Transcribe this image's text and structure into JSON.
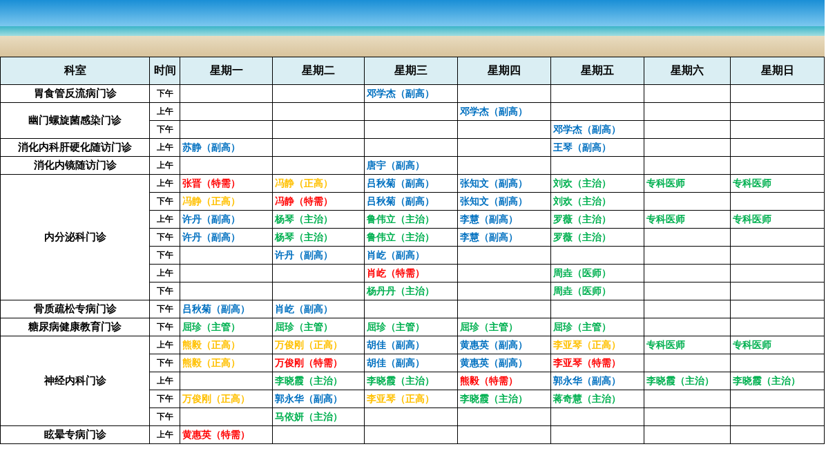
{
  "table": {
    "columns": [
      "科室",
      "时间",
      "星期一",
      "星期二",
      "星期三",
      "星期四",
      "星期五",
      "星期六",
      "星期日"
    ],
    "groups": [
      {
        "department": "胃食管反流病门诊",
        "rows": [
          {
            "time": "下午",
            "cells": [
              null,
              null,
              {
                "text": "邓学杰（副高）",
                "color": "#0070c0"
              },
              null,
              null,
              null,
              null
            ]
          }
        ]
      },
      {
        "department": "幽门螺旋菌感染门诊",
        "rows": [
          {
            "time": "上午",
            "cells": [
              null,
              null,
              null,
              {
                "text": "邓学杰（副高）",
                "color": "#0070c0"
              },
              null,
              null,
              null
            ]
          },
          {
            "time": "下午",
            "cells": [
              null,
              null,
              null,
              null,
              {
                "text": "邓学杰（副高）",
                "color": "#0070c0"
              },
              null,
              null
            ]
          }
        ]
      },
      {
        "department": "消化内科肝硬化随访门诊",
        "rows": [
          {
            "time": "上午",
            "cells": [
              {
                "text": "苏静（副高）",
                "color": "#0070c0"
              },
              null,
              null,
              null,
              {
                "text": "王琴（副高）",
                "color": "#0070c0"
              },
              null,
              null
            ]
          }
        ]
      },
      {
        "department": "消化内镜随访门诊",
        "rows": [
          {
            "time": "上午",
            "cells": [
              null,
              null,
              {
                "text": "唐宇（副高）",
                "color": "#0070c0"
              },
              null,
              null,
              null,
              null
            ]
          }
        ]
      },
      {
        "department": "内分泌科门诊",
        "rows": [
          {
            "time": "上午",
            "cells": [
              {
                "text": "张晋（特需）",
                "color": "#ff0000"
              },
              {
                "text": "冯静（正高）",
                "color": "#ffc000"
              },
              {
                "text": "吕秋菊（副高）",
                "color": "#0070c0"
              },
              {
                "text": "张知文（副高）",
                "color": "#0070c0"
              },
              {
                "text": "刘欢（主治）",
                "color": "#00b050"
              },
              {
                "text": "专科医师",
                "color": "#00b050"
              },
              {
                "text": "专科医师",
                "color": "#00b050"
              }
            ]
          },
          {
            "time": "下午",
            "cells": [
              {
                "text": "冯静（正高）",
                "color": "#ffc000"
              },
              {
                "text": "冯静（特需）",
                "color": "#ff0000"
              },
              {
                "text": "吕秋菊（副高）",
                "color": "#0070c0"
              },
              {
                "text": "张知文（副高）",
                "color": "#0070c0"
              },
              {
                "text": "刘欢（主治）",
                "color": "#00b050"
              },
              null,
              null
            ]
          },
          {
            "time": "上午",
            "cells": [
              {
                "text": "许丹（副高）",
                "color": "#0070c0"
              },
              {
                "text": "杨琴（主治）",
                "color": "#00b050"
              },
              {
                "text": "鲁伟立（主治）",
                "color": "#00b050"
              },
              {
                "text": "李慧（副高）",
                "color": "#0070c0"
              },
              {
                "text": "罗薇（主治）",
                "color": "#00b050"
              },
              {
                "text": "专科医师",
                "color": "#00b050"
              },
              {
                "text": "专科医师",
                "color": "#00b050"
              }
            ]
          },
          {
            "time": "下午",
            "cells": [
              {
                "text": "许丹（副高）",
                "color": "#0070c0"
              },
              {
                "text": "杨琴（主治）",
                "color": "#00b050"
              },
              {
                "text": "鲁伟立（主治）",
                "color": "#00b050"
              },
              {
                "text": "李慧（副高）",
                "color": "#0070c0"
              },
              {
                "text": "罗薇（主治）",
                "color": "#00b050"
              },
              null,
              null
            ]
          },
          {
            "time": "下午",
            "cells": [
              null,
              {
                "text": "许丹（副高）",
                "color": "#0070c0"
              },
              {
                "text": "肖屹（副高）",
                "color": "#0070c0"
              },
              null,
              null,
              null,
              null
            ]
          },
          {
            "time": "上午",
            "cells": [
              null,
              null,
              {
                "text": "肖屹（特需）",
                "color": "#ff0000"
              },
              null,
              {
                "text": "周垚（医师）",
                "color": "#00b050"
              },
              null,
              null
            ]
          },
          {
            "time": "下午",
            "cells": [
              null,
              null,
              {
                "text": "杨丹丹（主治）",
                "color": "#00b050"
              },
              null,
              {
                "text": "周垚（医师）",
                "color": "#00b050"
              },
              null,
              null
            ]
          }
        ]
      },
      {
        "department": "骨质疏松专病门诊",
        "rows": [
          {
            "time": "下午",
            "cells": [
              {
                "text": "吕秋菊（副高）",
                "color": "#0070c0"
              },
              {
                "text": "肖屹（副高）",
                "color": "#0070c0"
              },
              null,
              null,
              null,
              null,
              null
            ]
          }
        ]
      },
      {
        "department": "糖尿病健康教育门诊",
        "rows": [
          {
            "time": "下午",
            "cells": [
              {
                "text": "屈珍（主管）",
                "color": "#00b050"
              },
              {
                "text": "屈珍（主管）",
                "color": "#00b050"
              },
              {
                "text": "屈珍（主管）",
                "color": "#00b050"
              },
              {
                "text": "屈珍（主管）",
                "color": "#00b050"
              },
              {
                "text": "屈珍（主管）",
                "color": "#00b050"
              },
              null,
              null
            ]
          }
        ]
      },
      {
        "department": "神经内科门诊",
        "rows": [
          {
            "time": "上午",
            "cells": [
              {
                "text": "熊毅（正高）",
                "color": "#ffc000"
              },
              {
                "text": "万俊刚（正高）",
                "color": "#ffc000"
              },
              {
                "text": "胡佳（副高）",
                "color": "#0070c0"
              },
              {
                "text": "黄惠英（副高）",
                "color": "#0070c0"
              },
              {
                "text": "李亚琴（正高）",
                "color": "#ffc000"
              },
              {
                "text": "专科医师",
                "color": "#00b050"
              },
              {
                "text": "专科医师",
                "color": "#00b050"
              }
            ]
          },
          {
            "time": "下午",
            "cells": [
              {
                "text": "熊毅（正高）",
                "color": "#ffc000"
              },
              {
                "text": "万俊刚（特需）",
                "color": "#ff0000"
              },
              {
                "text": "胡佳（副高）",
                "color": "#0070c0"
              },
              {
                "text": "黄惠英（副高）",
                "color": "#0070c0"
              },
              {
                "text": "李亚琴（特需）",
                "color": "#ff0000"
              },
              null,
              null
            ]
          },
          {
            "time": "上午",
            "cells": [
              null,
              {
                "text": "李晓霞（主治）",
                "color": "#00b050"
              },
              {
                "text": "李晓霞（主治）",
                "color": "#00b050"
              },
              {
                "text": "熊毅（特需）",
                "color": "#ff0000"
              },
              {
                "text": "郭永华（副高）",
                "color": "#0070c0"
              },
              {
                "text": "李晓霞（主治）",
                "color": "#00b050"
              },
              {
                "text": "李晓霞（主治）",
                "color": "#00b050"
              }
            ]
          },
          {
            "time": "下午",
            "cells": [
              {
                "text": "万俊刚（正高）",
                "color": "#ffc000"
              },
              {
                "text": "郭永华（副高）",
                "color": "#0070c0"
              },
              {
                "text": "李亚琴（正高）",
                "color": "#ffc000"
              },
              {
                "text": "李晓霞（主治）",
                "color": "#00b050"
              },
              {
                "text": "蒋奇慧（主治）",
                "color": "#00b050"
              },
              null,
              null
            ]
          },
          {
            "time": "下午",
            "cells": [
              null,
              {
                "text": "马依妍（主治）",
                "color": "#00b050"
              },
              null,
              null,
              null,
              null,
              null
            ]
          }
        ]
      },
      {
        "department": "眩晕专病门诊",
        "rows": [
          {
            "time": "上午",
            "cells": [
              {
                "text": "黄惠英（特需）",
                "color": "#ff0000"
              },
              null,
              null,
              null,
              null,
              null,
              null
            ]
          }
        ]
      }
    ]
  }
}
